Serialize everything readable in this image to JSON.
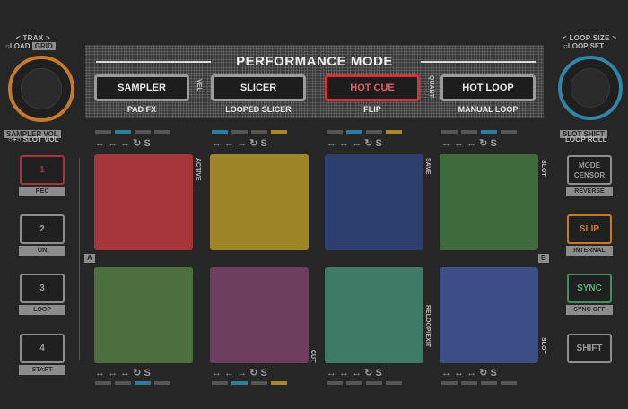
{
  "left_deck": {
    "trax_label": "TRAX",
    "load_label": "LOAD",
    "grid_label": "GRID",
    "sampler_vol_label": "SAMPLER VOL",
    "slot_vol_label": "SLOT VOL"
  },
  "right_deck": {
    "loop_size_label": "LOOP SIZE",
    "loop_set_label": "LOOP SET",
    "slot_shift_label": "SLOT SHIFT",
    "loop_roll_label": "LOOP ROLL"
  },
  "performance": {
    "title": "PERFORMANCE MODE",
    "vel_label": "VEL",
    "quant_label": "QUANT",
    "modes": [
      {
        "label": "SAMPLER",
        "sub": "PAD FX"
      },
      {
        "label": "SLICER",
        "sub": "LOOPED SLICER"
      },
      {
        "label": "HOT CUE",
        "sub": "FLIP"
      },
      {
        "label": "HOT LOOP",
        "sub": "MANUAL LOOP"
      }
    ]
  },
  "left_buttons": [
    {
      "label": "1",
      "sub": "REC"
    },
    {
      "label": "2",
      "sub": "ON"
    },
    {
      "label": "3",
      "sub": "LOOP"
    },
    {
      "label": "4",
      "sub": "START"
    }
  ],
  "right_buttons": [
    {
      "label": "MODE CENSOR",
      "sub": "REVERSE"
    },
    {
      "label": "SLIP",
      "sub": "INTERNAL"
    },
    {
      "label": "SYNC",
      "sub": "SYNC OFF"
    },
    {
      "label": "SHIFT",
      "sub": ""
    }
  ],
  "pad_side_labels": {
    "active": "ACTIVE",
    "save": "SAVE",
    "slot": "SLOT",
    "reloop_exit": "RELOOP/EXIT",
    "cut": "CUT",
    "slot_bottom": "SLOT",
    "a": "A",
    "b": "B"
  },
  "strip_icon_label": "S",
  "colors": {
    "background": "#262626",
    "knob_left": "#c57a2a",
    "knob_right": "#2f86a6",
    "active_mode": "#d6323a",
    "pads": [
      "#a5363a",
      "#9d8528",
      "#2c3f6e",
      "#3f6a3a",
      "#4b6f3e",
      "#6e3e5e",
      "#3f7a67",
      "#3b4e86"
    ],
    "slip_button": "#c57a2a",
    "sync_button": "#3f8f5a"
  }
}
